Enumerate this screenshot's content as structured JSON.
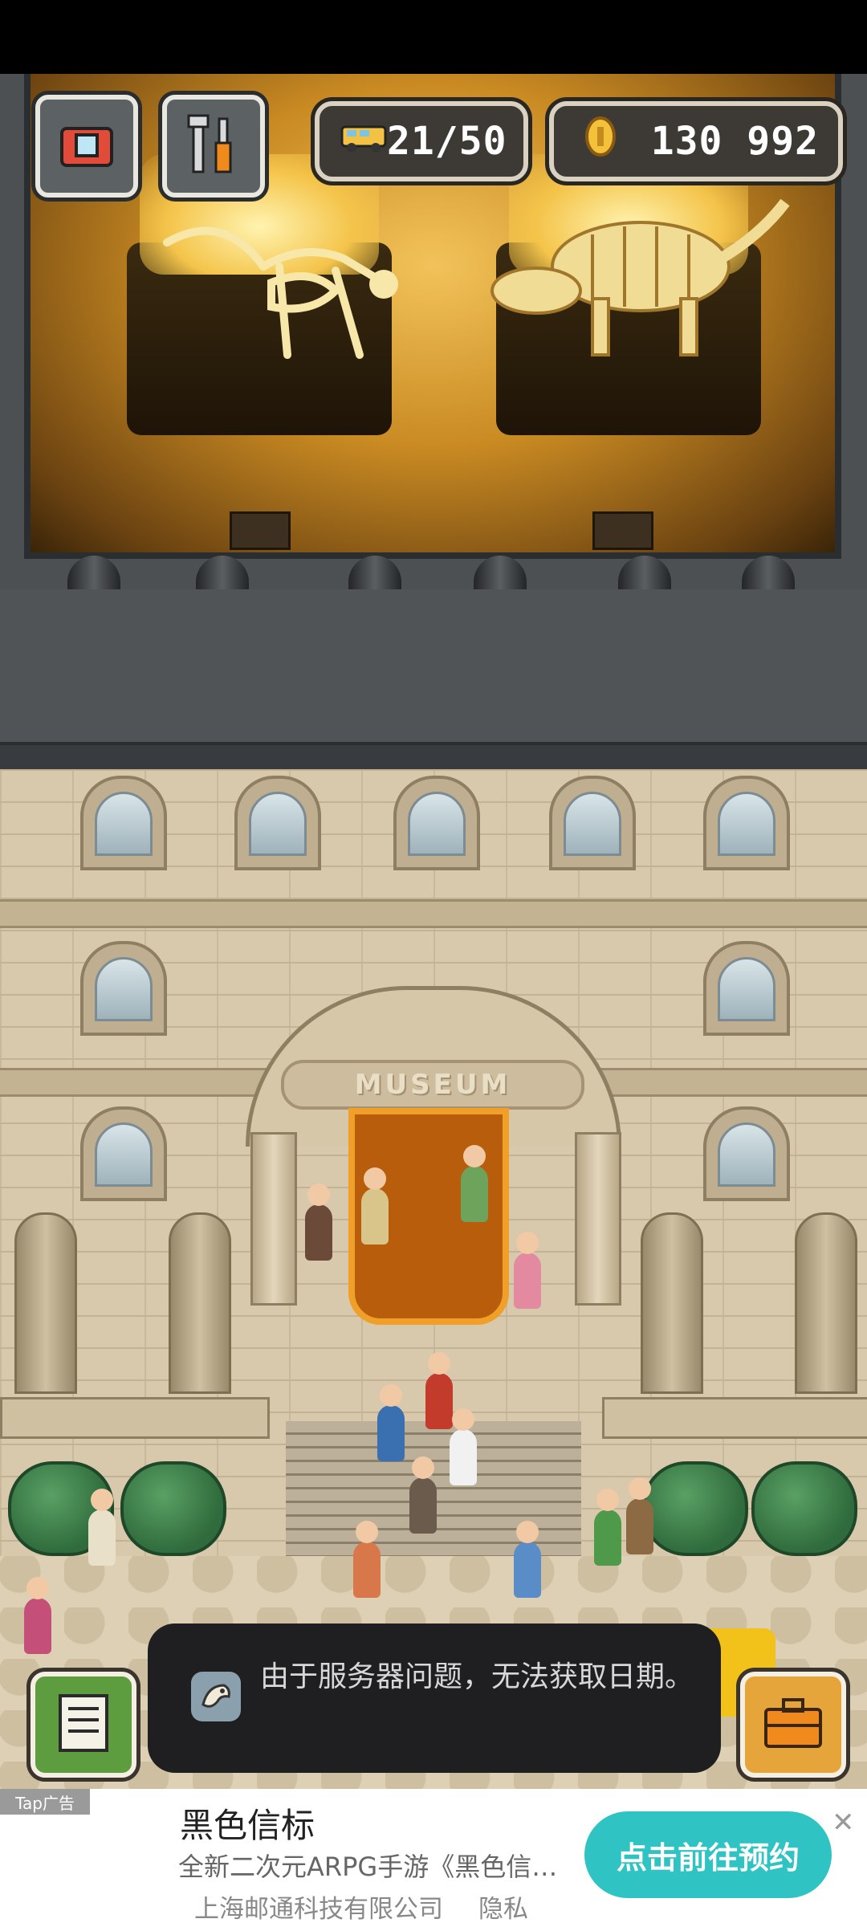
{
  "hud": {
    "visitors": "21/50",
    "coins": "130 992",
    "camera_icon": "camera-icon",
    "tools_icon": "tools-icon",
    "visitor_icon": "bus-icon",
    "coin_icon": "coin-icon"
  },
  "museum": {
    "sign": "MUSEUM"
  },
  "toast": {
    "message": "由于服务器问题，无法获取日期。",
    "icon": "fossil-icon"
  },
  "game_buttons": {
    "notes_icon": "notebook-icon",
    "case_icon": "briefcase-icon"
  },
  "ad": {
    "tag": "Tap广告",
    "title": "黑色信标",
    "description": "全新二次元ARPG手游《黑色信…",
    "company": "上海邮通科技有限公司",
    "privacy": "隐私",
    "cta": "点击前往预约",
    "close": "✕"
  },
  "colors": {
    "accent_cta": "#2fc3c3",
    "hall_gold": "#f2c35a",
    "carpet": "#b85d0c"
  }
}
